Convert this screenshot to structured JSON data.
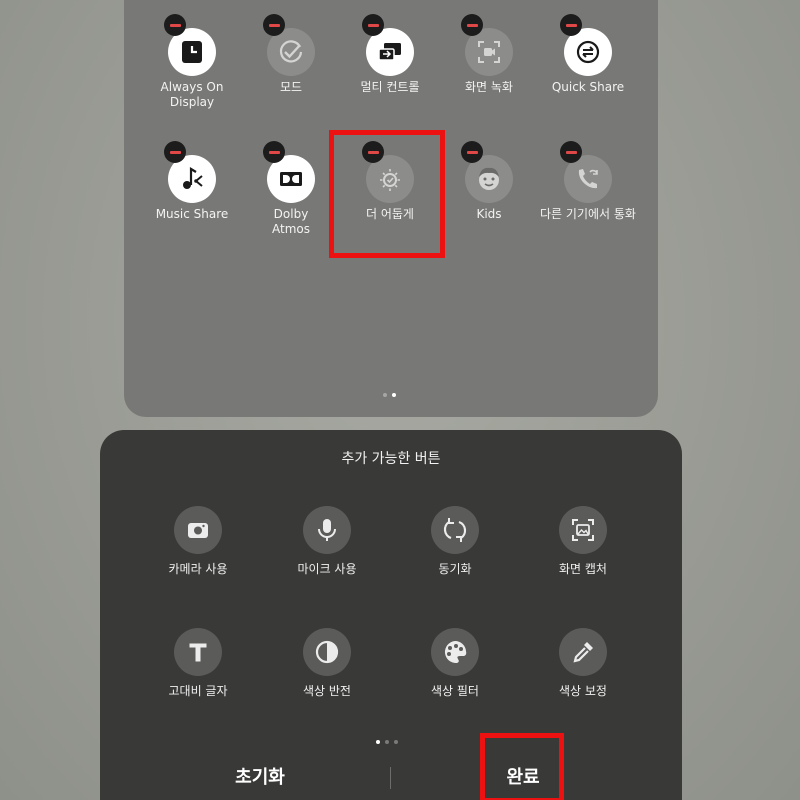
{
  "active_tiles": [
    {
      "label": "Always On\nDisplay",
      "icon": "clock-icon",
      "state": "on"
    },
    {
      "label": "모드",
      "icon": "check-circle-icon",
      "state": "off"
    },
    {
      "label": "멀티 컨트롤",
      "icon": "multi-screen-icon",
      "state": "on"
    },
    {
      "label": "화면 녹화",
      "icon": "screen-record-icon",
      "state": "off"
    },
    {
      "label": "Quick Share",
      "icon": "share-arrows-icon",
      "state": "on"
    },
    {
      "label": "Music Share",
      "icon": "music-share-icon",
      "state": "on"
    },
    {
      "label": "Dolby\nAtmos",
      "icon": "dolby-icon",
      "state": "on"
    },
    {
      "label": "더 어둡게",
      "icon": "dim-sun-icon",
      "state": "off"
    },
    {
      "label": "Kids",
      "icon": "kids-face-icon",
      "state": "off"
    },
    {
      "label": "다른 기기에서 통화",
      "icon": "phone-sync-icon",
      "state": "off"
    }
  ],
  "available": {
    "title": "추가 가능한 버튼",
    "tiles": [
      {
        "label": "카메라 사용",
        "icon": "camera-icon"
      },
      {
        "label": "마이크 사용",
        "icon": "mic-icon"
      },
      {
        "label": "동기화",
        "icon": "sync-icon"
      },
      {
        "label": "화면 캡처",
        "icon": "screen-capture-icon"
      },
      {
        "label": "고대비 글자",
        "icon": "text-t-icon"
      },
      {
        "label": "색상 반전",
        "icon": "invert-icon"
      },
      {
        "label": "색상 필터",
        "icon": "palette-icon"
      },
      {
        "label": "색상 보정",
        "icon": "dropper-icon"
      }
    ]
  },
  "footer": {
    "reset_label": "초기화",
    "done_label": "완료"
  },
  "colors": {
    "highlight": "#ee1111",
    "remove_badge": "#e04848"
  }
}
